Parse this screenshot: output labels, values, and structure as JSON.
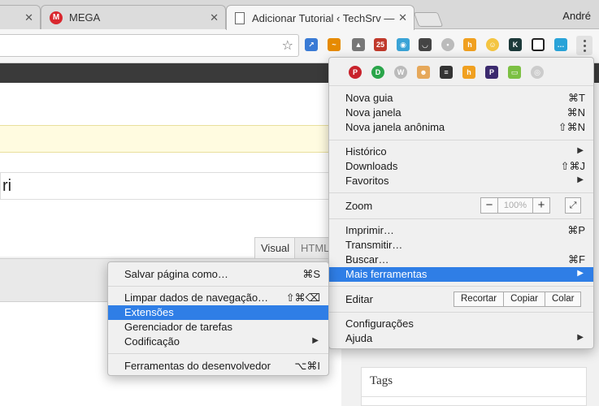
{
  "tabs": [
    {
      "label": ""
    },
    {
      "label": "MEGA",
      "favicon": "mega-icon",
      "favicon_color": "#d9272e"
    },
    {
      "label": "Adicionar Tutorial ‹ TechSrv —",
      "favicon": "document-icon",
      "active": true
    }
  ],
  "user": {
    "name": "André"
  },
  "page": {
    "title_fragment": "ri",
    "editor_tabs": {
      "visual": "Visual",
      "html": "HTML"
    },
    "tags_heading": "Tags"
  },
  "main_menu": {
    "sections": {
      "nova_guia": {
        "label": "Nova guia",
        "shortcut": "⌘T"
      },
      "nova_janela": {
        "label": "Nova janela",
        "shortcut": "⌘N"
      },
      "nova_janela_anonima": {
        "label": "Nova janela anônima",
        "shortcut": "⇧⌘N"
      },
      "historico": {
        "label": "Histórico"
      },
      "downloads": {
        "label": "Downloads",
        "shortcut": "⇧⌘J"
      },
      "favoritos": {
        "label": "Favoritos"
      },
      "zoom": {
        "label": "Zoom",
        "minus": "−",
        "value": "100%",
        "plus": "+"
      },
      "imprimir": {
        "label": "Imprimir…",
        "shortcut": "⌘P"
      },
      "transmitir": {
        "label": "Transmitir…"
      },
      "buscar": {
        "label": "Buscar…",
        "shortcut": "⌘F"
      },
      "mais_ferramentas": {
        "label": "Mais ferramentas"
      },
      "editar": {
        "label": "Editar",
        "cut": "Recortar",
        "copy": "Copiar",
        "paste": "Colar"
      },
      "configuracoes": {
        "label": "Configurações"
      },
      "ajuda": {
        "label": "Ajuda"
      }
    }
  },
  "sub_menu": {
    "salvar": {
      "label": "Salvar página como…",
      "shortcut": "⌘S"
    },
    "limpar": {
      "label": "Limpar dados de navegação…",
      "shortcut": "⇧⌘⌫"
    },
    "extensoes": {
      "label": "Extensões"
    },
    "gerenciador": {
      "label": "Gerenciador de tarefas"
    },
    "codificacao": {
      "label": "Codificação"
    },
    "devtools": {
      "label": "Ferramentas do desenvolvedor",
      "shortcut": "⌥⌘I"
    }
  },
  "colors": {
    "highlight": "#2f7ee6",
    "menu_bg": "#f0f0f0",
    "tab_bg": "#d9d9d9"
  }
}
